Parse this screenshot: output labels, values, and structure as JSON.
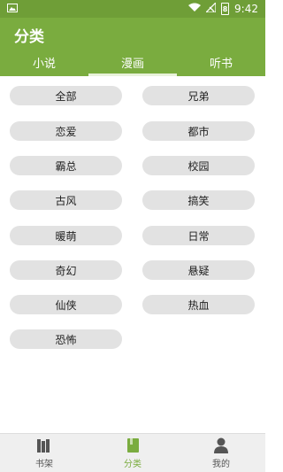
{
  "status_bar": {
    "time": "9:42",
    "battery_level": "8"
  },
  "app": {
    "title": "分类"
  },
  "tabs": [
    {
      "label": "小说",
      "active": false
    },
    {
      "label": "漫画",
      "active": true
    },
    {
      "label": "听书",
      "active": false
    }
  ],
  "categories": [
    {
      "label": "全部"
    },
    {
      "label": "兄弟"
    },
    {
      "label": "恋爱"
    },
    {
      "label": "都市"
    },
    {
      "label": "霸总"
    },
    {
      "label": "校园"
    },
    {
      "label": "古风"
    },
    {
      "label": "搞笑"
    },
    {
      "label": "暖萌"
    },
    {
      "label": "日常"
    },
    {
      "label": "奇幻"
    },
    {
      "label": "悬疑"
    },
    {
      "label": "仙侠"
    },
    {
      "label": "热血"
    },
    {
      "label": "恐怖"
    }
  ],
  "bottom_nav": [
    {
      "label": "书架",
      "icon": "bookshelf-icon",
      "active": false
    },
    {
      "label": "分类",
      "icon": "category-book-icon",
      "active": true
    },
    {
      "label": "我的",
      "icon": "person-icon",
      "active": false
    }
  ],
  "colors": {
    "primary": "#7aac3f",
    "status_bar": "#6f9e37",
    "chip_bg": "#e2e2e2"
  }
}
